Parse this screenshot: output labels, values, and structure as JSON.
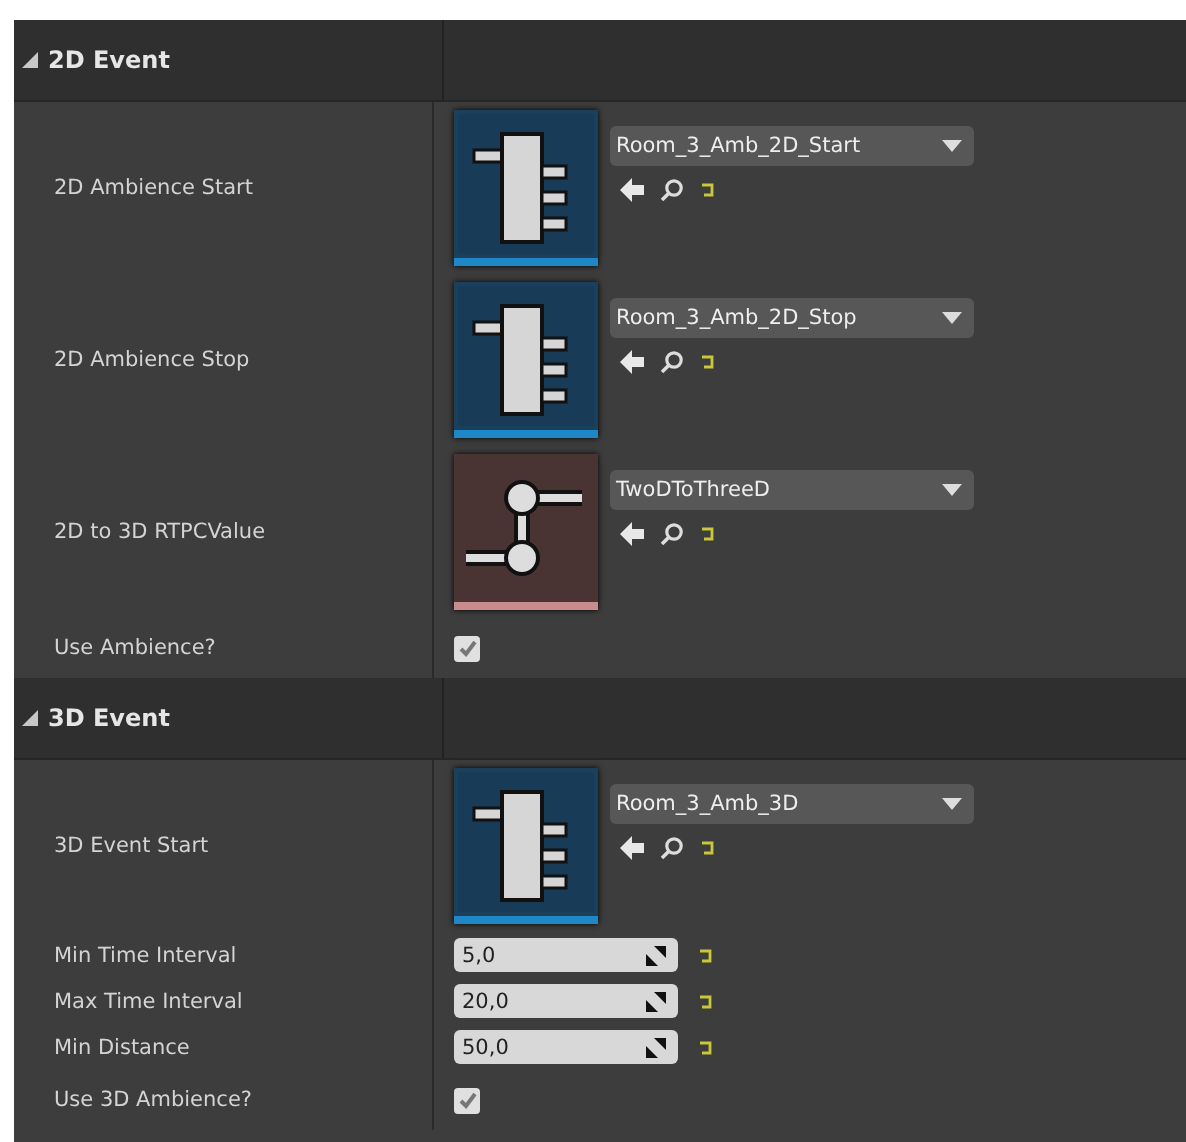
{
  "sections": [
    {
      "title": "2D Event",
      "expanded": true,
      "rows": [
        {
          "kind": "event",
          "label": "2D Ambience Start",
          "value": "Room_3_Amb_2D_Start"
        },
        {
          "kind": "event",
          "label": "2D Ambience Stop",
          "value": "Room_3_Amb_2D_Stop"
        },
        {
          "kind": "rtpc",
          "label": "2D to 3D RTPCValue",
          "value": "TwoDToThreeD"
        },
        {
          "kind": "checkbox",
          "label": "Use Ambience?",
          "checked": true
        }
      ]
    },
    {
      "title": "3D Event",
      "expanded": true,
      "rows": [
        {
          "kind": "event",
          "label": "3D Event Start",
          "value": "Room_3_Amb_3D"
        },
        {
          "kind": "number",
          "label": "Min Time Interval",
          "value": "5,0"
        },
        {
          "kind": "number",
          "label": "Max Time Interval",
          "value": "20,0"
        },
        {
          "kind": "number",
          "label": "Min Distance",
          "value": "50,0"
        },
        {
          "kind": "checkbox",
          "label": "Use 3D Ambience?",
          "checked": true
        }
      ]
    }
  ]
}
